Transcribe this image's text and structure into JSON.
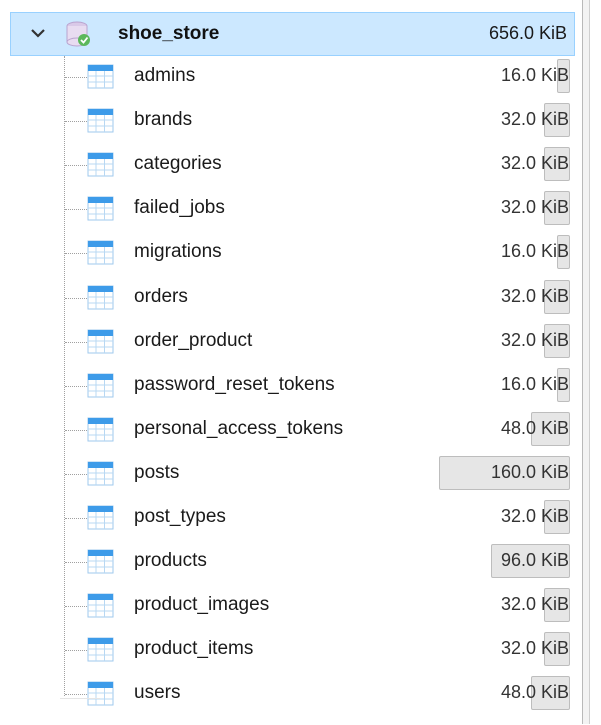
{
  "database": {
    "name": "shoe_store",
    "size": "656.0 KiB",
    "expanded": true
  },
  "bar_max_kib": 160,
  "tables": [
    {
      "name": "admins",
      "size": "16.0 KiB",
      "kib": 16
    },
    {
      "name": "brands",
      "size": "32.0 KiB",
      "kib": 32
    },
    {
      "name": "categories",
      "size": "32.0 KiB",
      "kib": 32
    },
    {
      "name": "failed_jobs",
      "size": "32.0 KiB",
      "kib": 32
    },
    {
      "name": "migrations",
      "size": "16.0 KiB",
      "kib": 16
    },
    {
      "name": "orders",
      "size": "32.0 KiB",
      "kib": 32
    },
    {
      "name": "order_product",
      "size": "32.0 KiB",
      "kib": 32
    },
    {
      "name": "password_reset_tokens",
      "size": "16.0 KiB",
      "kib": 16
    },
    {
      "name": "personal_access_tokens",
      "size": "48.0 KiB",
      "kib": 48
    },
    {
      "name": "posts",
      "size": "160.0 KiB",
      "kib": 160
    },
    {
      "name": "post_types",
      "size": "32.0 KiB",
      "kib": 32
    },
    {
      "name": "products",
      "size": "96.0 KiB",
      "kib": 96
    },
    {
      "name": "product_images",
      "size": "32.0 KiB",
      "kib": 32
    },
    {
      "name": "product_items",
      "size": "32.0 KiB",
      "kib": 32
    },
    {
      "name": "users",
      "size": "48.0 KiB",
      "kib": 48
    }
  ],
  "icons": {
    "expand": "chevron-down-icon",
    "database": "database-icon",
    "table": "table-icon"
  },
  "colors": {
    "selection_bg": "#cce8ff",
    "selection_border": "#99d1ff",
    "size_bar": "#e6e6e6",
    "table_icon": "#3d9be9"
  }
}
